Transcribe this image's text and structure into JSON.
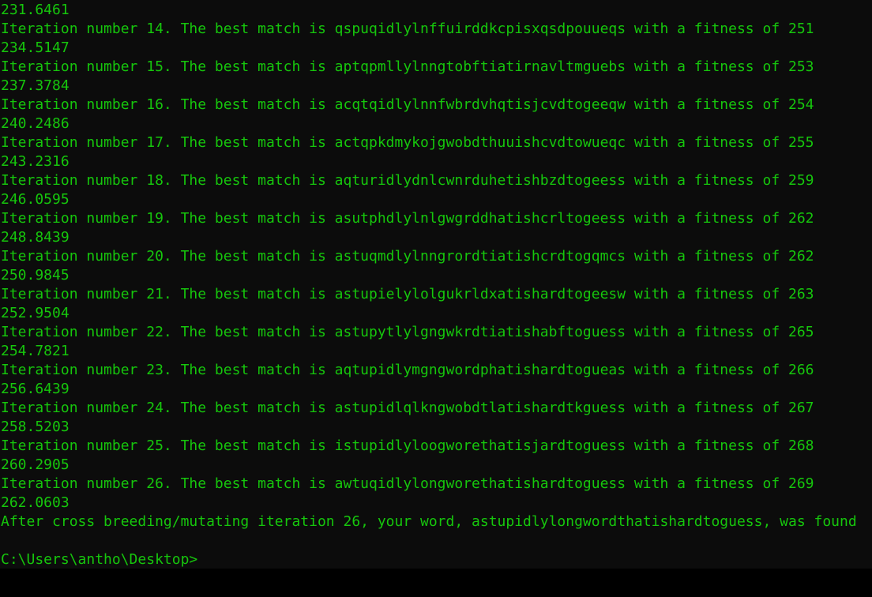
{
  "terminal": {
    "text_color": "#16c60c",
    "background": "#0c0c0c",
    "lines": [
      "231.6461",
      "Iteration number 14. The best match is qspuqidlylnffuirddkcpisxqsdpouueqs with a fitness of 251",
      "234.5147",
      "Iteration number 15. The best match is aptqpmllylnngtobftiatirnavltmguebs with a fitness of 253",
      "237.3784",
      "Iteration number 16. The best match is acqtqidlylnnfwbrdvhqtisjcvdtogeeqw with a fitness of 254",
      "240.2486",
      "Iteration number 17. The best match is actqpkdmykojgwobdthuuishcvdtowueqc with a fitness of 255",
      "243.2316",
      "Iteration number 18. The best match is aqturidlydnlcwnrduhetishbzdtogeess with a fitness of 259",
      "246.0595",
      "Iteration number 19. The best match is asutphdlylnlgwgrddhatishcrltogeess with a fitness of 262",
      "248.8439",
      "Iteration number 20. The best match is astuqmdlylnngrordtiatishcrdtogqmcs with a fitness of 262",
      "250.9845",
      "Iteration number 21. The best match is astupielylolgukrldxatishardtogeesw with a fitness of 263",
      "252.9504",
      "Iteration number 22. The best match is astupytlylgngwkrdtiatishabftoguess with a fitness of 265",
      "254.7821",
      "Iteration number 23. The best match is aqtupidlymgngwordphatishardtogueas with a fitness of 266",
      "256.6439",
      "Iteration number 24. The best match is astupidlqlkngwobdtlatishardtkguess with a fitness of 267",
      "258.5203",
      "Iteration number 25. The best match is istupidlyloogworethatisjardtoguess with a fitness of 268",
      "260.2905",
      "Iteration number 26. The best match is awtuqidlylongworethatishardtoguess with a fitness of 269",
      "262.0603",
      "After cross breeding/mutating iteration 26, your word, astupidlylongwordthatishardtoguess, was found",
      ""
    ],
    "prompt": "C:\\Users\\antho\\Desktop>"
  }
}
